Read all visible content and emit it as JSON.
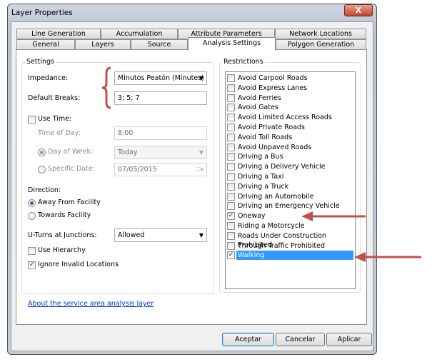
{
  "window": {
    "title": "Layer Properties",
    "close_label": "X"
  },
  "tabs_row1": [
    "Line Generation",
    "Accumulation",
    "Attribute Parameters",
    "Network Locations"
  ],
  "tabs_row2": [
    "General",
    "Layers",
    "Source",
    "Analysis Settings",
    "Polygon Generation"
  ],
  "active_tab": "Analysis Settings",
  "settings": {
    "group_label": "Settings",
    "impedance_label": "Impedance:",
    "impedance_value": "Minutos Peatón (Minutes)",
    "default_breaks_label": "Default Breaks:",
    "default_breaks_value": "3; 5; 7",
    "use_time_label": "Use Time:",
    "use_time_checked": false,
    "time_of_day_label": "Time of Day:",
    "time_of_day_value": "8:00",
    "day_of_week_label": "Day of Week:",
    "day_of_week_value": "Today",
    "specific_date_label": "Specific Date:",
    "specific_date_value": "07/05/2015",
    "direction_label": "Direction:",
    "away_label": "Away From Facility",
    "towards_label": "Towards Facility",
    "direction_selected": "Away From Facility",
    "uturns_label": "U-Turns at Junctions:",
    "uturns_value": "Allowed",
    "use_hierarchy_label": "Use Hierarchy",
    "use_hierarchy_checked": false,
    "ignore_invalid_label": "Ignore Invalid Locations",
    "ignore_invalid_checked": true
  },
  "restrictions": {
    "group_label": "Restrictions",
    "items": [
      {
        "label": "Avoid Carpool Roads",
        "checked": false
      },
      {
        "label": "Avoid Express Lanes",
        "checked": false
      },
      {
        "label": "Avoid Ferries",
        "checked": false
      },
      {
        "label": "Avoid Gates",
        "checked": false
      },
      {
        "label": "Avoid Limited Access Roads",
        "checked": false
      },
      {
        "label": "Avoid Private Roads",
        "checked": false
      },
      {
        "label": "Avoid Toll Roads",
        "checked": false
      },
      {
        "label": "Avoid Unpaved Roads",
        "checked": false
      },
      {
        "label": "Driving a Bus",
        "checked": false
      },
      {
        "label": "Driving a Delivery Vehicle",
        "checked": false
      },
      {
        "label": "Driving a Taxi",
        "checked": false
      },
      {
        "label": "Driving a Truck",
        "checked": false
      },
      {
        "label": "Driving an Automobile",
        "checked": false
      },
      {
        "label": "Driving an Emergency Vehicle",
        "checked": false
      },
      {
        "label": "Oneway",
        "checked": true
      },
      {
        "label": "Riding a Motorcycle",
        "checked": false
      },
      {
        "label": "Roads Under Construction Prohibited",
        "checked": false
      },
      {
        "label": "Through Traffic Prohibited",
        "checked": false
      },
      {
        "label": "Walking",
        "checked": true,
        "selected": true
      }
    ]
  },
  "about_link": "About the service area analysis layer",
  "buttons": {
    "ok": "Aceptar",
    "cancel": "Cancelar",
    "apply": "Aplicar"
  },
  "colors": {
    "annotation_red": "#c0504d",
    "selection": "#3399ff",
    "link": "#0033cc"
  }
}
